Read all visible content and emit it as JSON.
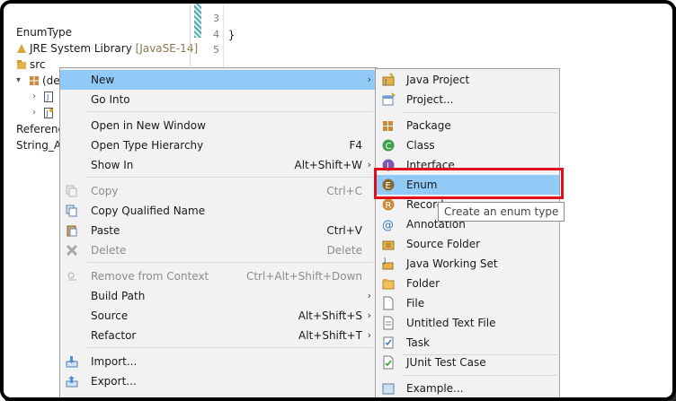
{
  "tree": {
    "project_name": "EnumType",
    "jre_label": "JRE System Library",
    "jre_version": "[JavaSE-14]",
    "src_label": "src",
    "package_label": "(de",
    "referenced_label": "Referenc",
    "string_label": "String_A"
  },
  "editor": {
    "line_numbers": [
      "3",
      "4",
      "5"
    ],
    "code_brace": "}"
  },
  "context_menu": {
    "items": [
      {
        "label": "New",
        "accel": "",
        "submenu": true,
        "disabled": false,
        "highlighted": true
      },
      {
        "label": "Go Into",
        "accel": "",
        "submenu": false,
        "disabled": false
      },
      {
        "label": "Open in New Window",
        "accel": "",
        "submenu": false,
        "disabled": false
      },
      {
        "label": "Open Type Hierarchy",
        "accel": "F4",
        "submenu": false,
        "disabled": false
      },
      {
        "label": "Show In",
        "accel": "Alt+Shift+W",
        "submenu": true,
        "disabled": false
      },
      {
        "label": "Copy",
        "accel": "Ctrl+C",
        "submenu": false,
        "disabled": true
      },
      {
        "label": "Copy Qualified Name",
        "accel": "",
        "submenu": false,
        "disabled": false
      },
      {
        "label": "Paste",
        "accel": "Ctrl+V",
        "submenu": false,
        "disabled": false
      },
      {
        "label": "Delete",
        "accel": "Delete",
        "submenu": false,
        "disabled": true
      },
      {
        "label": "Remove from Context",
        "accel": "Ctrl+Alt+Shift+Down",
        "submenu": false,
        "disabled": true
      },
      {
        "label": "Build Path",
        "accel": "",
        "submenu": true,
        "disabled": false
      },
      {
        "label": "Source",
        "accel": "Alt+Shift+S",
        "submenu": true,
        "disabled": false
      },
      {
        "label": "Refactor",
        "accel": "Alt+Shift+T",
        "submenu": true,
        "disabled": false
      },
      {
        "label": "Import...",
        "accel": "",
        "submenu": false,
        "disabled": false
      },
      {
        "label": "Export...",
        "accel": "",
        "submenu": false,
        "disabled": false
      }
    ]
  },
  "new_submenu": {
    "items": [
      {
        "label": "Java Project",
        "icon": "java-project-icon"
      },
      {
        "label": "Project...",
        "icon": "project-icon"
      },
      {
        "label": "Package",
        "icon": "package-icon"
      },
      {
        "label": "Class",
        "icon": "class-icon"
      },
      {
        "label": "Interface",
        "icon": "interface-icon"
      },
      {
        "label": "Enum",
        "icon": "enum-icon",
        "highlighted": true
      },
      {
        "label": "Record",
        "icon": "record-icon"
      },
      {
        "label": "Annotation",
        "icon": "annotation-icon"
      },
      {
        "label": "Source Folder",
        "icon": "source-folder-icon"
      },
      {
        "label": "Java Working Set",
        "icon": "working-set-icon"
      },
      {
        "label": "Folder",
        "icon": "folder-icon"
      },
      {
        "label": "File",
        "icon": "file-icon"
      },
      {
        "label": "Untitled Text File",
        "icon": "text-file-icon"
      },
      {
        "label": "Task",
        "icon": "task-icon"
      },
      {
        "label": "JUnit Test Case",
        "icon": "junit-icon"
      },
      {
        "label": "Example...",
        "icon": "example-icon"
      }
    ]
  },
  "tooltip": {
    "text": "Create an enum type"
  },
  "colors": {
    "highlight": "#91c9f7",
    "annotation_box": "#e0101a",
    "menu_bg": "#f2f2f2"
  }
}
